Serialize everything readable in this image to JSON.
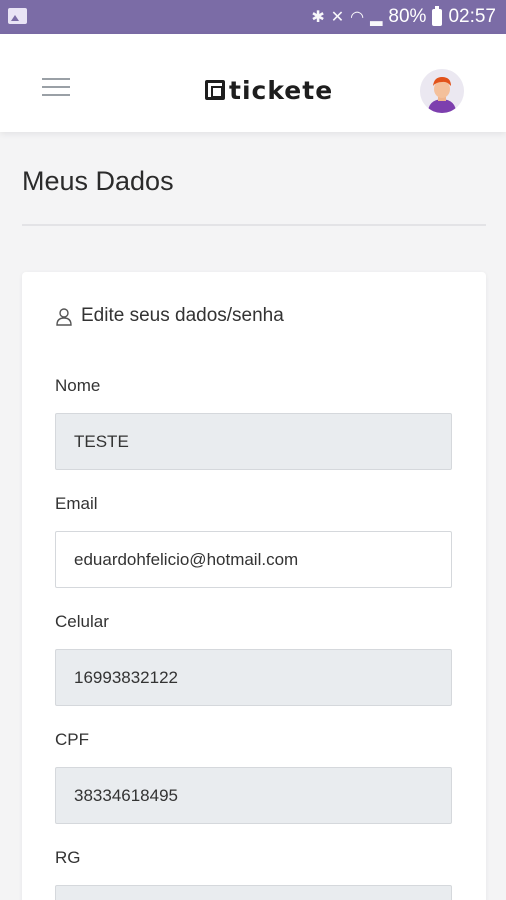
{
  "status_bar": {
    "battery": "80%",
    "time": "02:57"
  },
  "header": {
    "logo_text": "tickete"
  },
  "page": {
    "title": "Meus Dados"
  },
  "card": {
    "heading": "Edite seus dados/senha",
    "fields": [
      {
        "label": "Nome",
        "value": "TESTE",
        "editable": false
      },
      {
        "label": "Email",
        "value": "eduardohfelicio@hotmail.com",
        "editable": true
      },
      {
        "label": "Celular",
        "value": "16993832122",
        "editable": false
      },
      {
        "label": "CPF",
        "value": "38334618495",
        "editable": false
      },
      {
        "label": "RG",
        "value": "",
        "editable": false
      }
    ]
  },
  "colors": {
    "status_bar": "#7b6ca6",
    "disabled_field": "#e9ecef",
    "page_background": "#f4f4f5"
  }
}
